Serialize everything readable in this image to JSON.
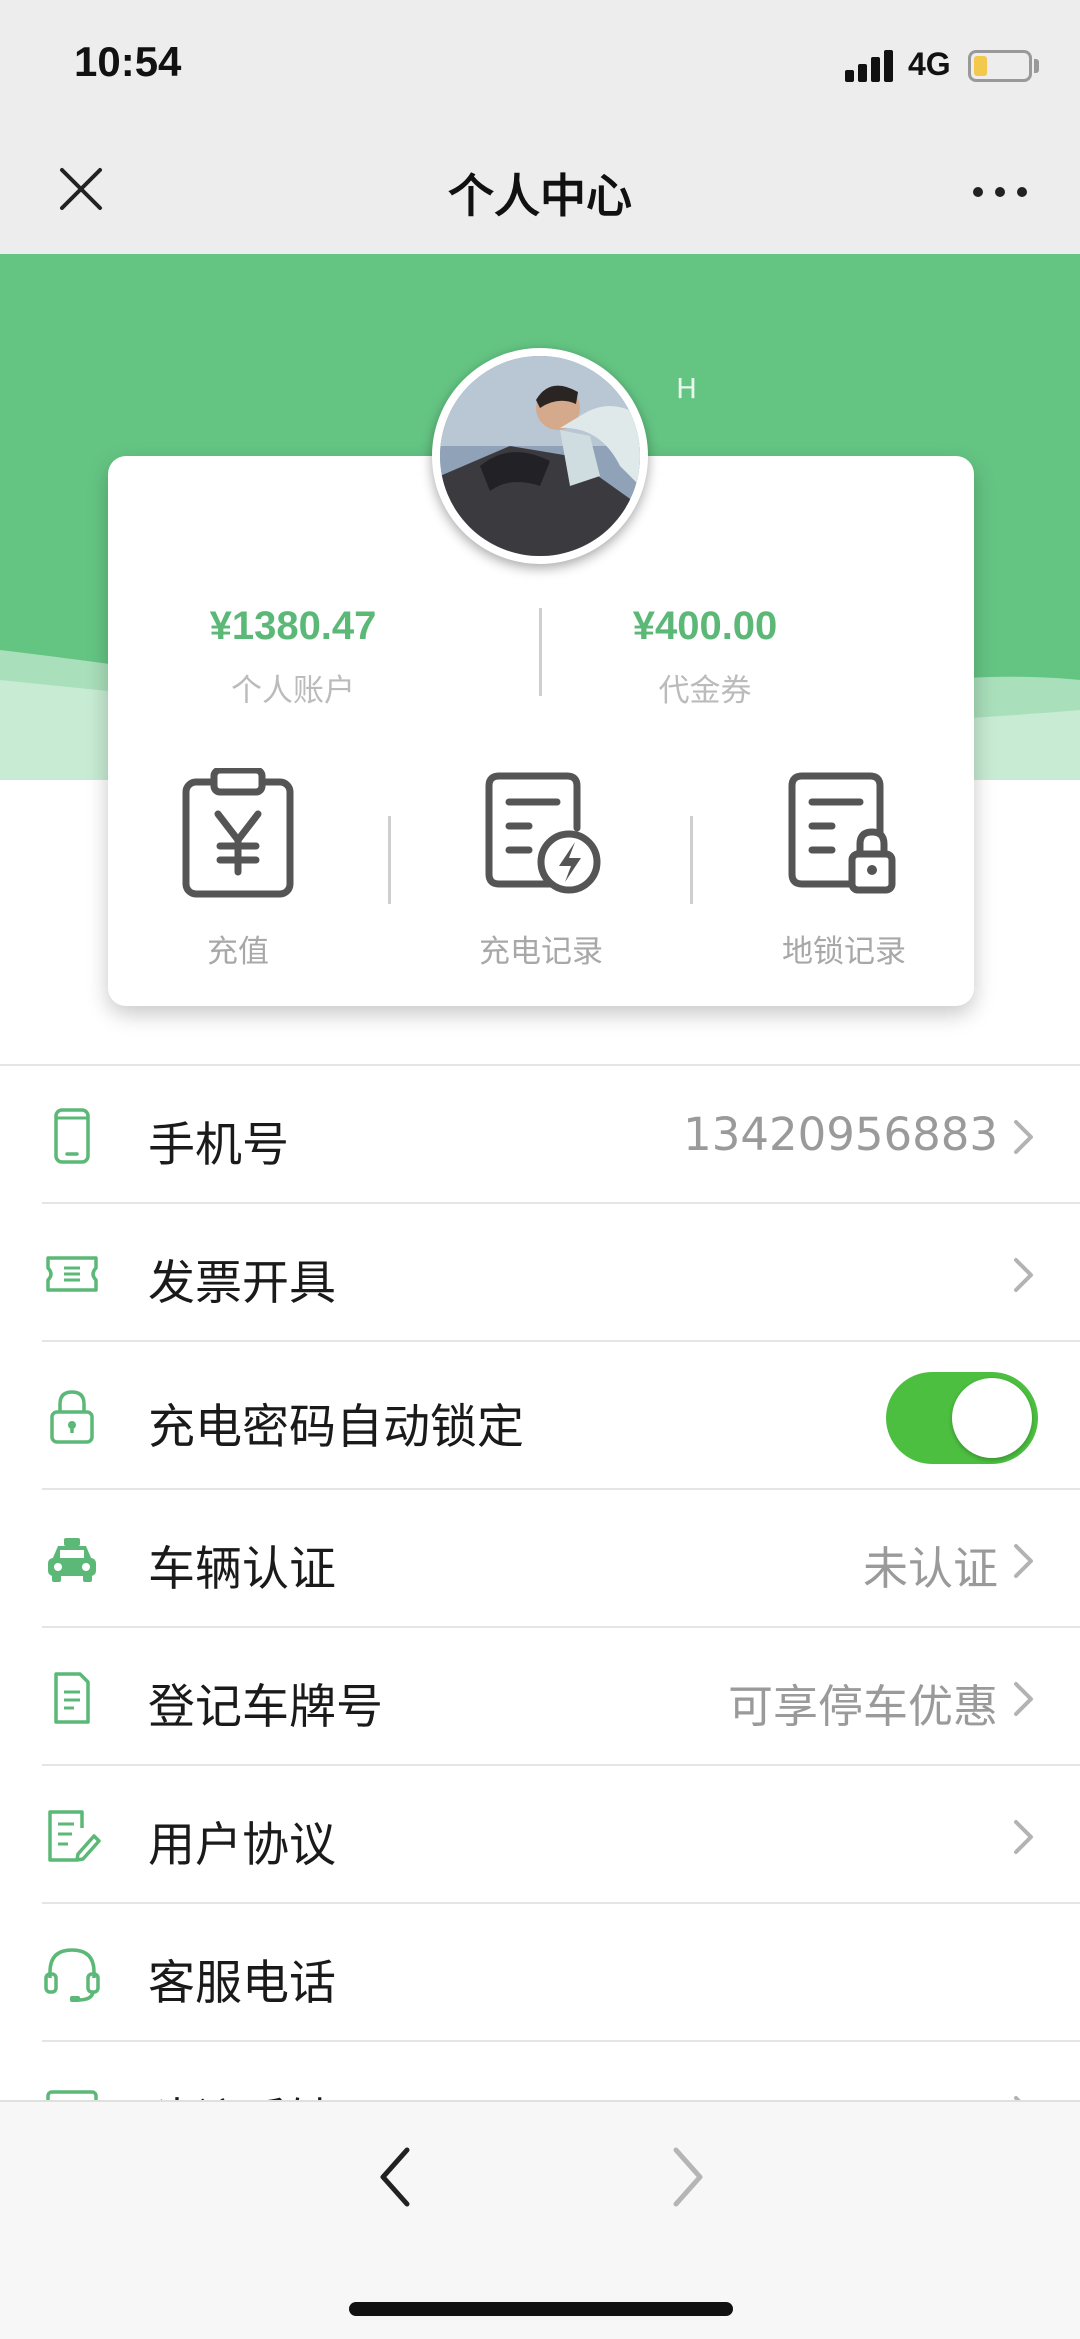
{
  "status_bar": {
    "time": "10:54",
    "network": "4G",
    "battery_level_percent": 25
  },
  "nav": {
    "title": "个人中心",
    "close_icon": "close-icon",
    "more_icon": "more-dots-icon"
  },
  "profile": {
    "name": "H",
    "avatar_icon": "avatar-photo"
  },
  "account": {
    "balance_amount": "¥1380.47",
    "balance_label": "个人账户",
    "coupon_amount": "¥400.00",
    "coupon_label": "代金券"
  },
  "actions": [
    {
      "label": "充值",
      "icon": "recharge-clipboard-yen-icon"
    },
    {
      "label": "充电记录",
      "icon": "charge-record-bolt-icon"
    },
    {
      "label": "地锁记录",
      "icon": "lock-record-icon"
    }
  ],
  "menu": [
    {
      "label": "手机号",
      "value": "13420956883",
      "icon": "phone-icon"
    },
    {
      "label": "发票开具",
      "value": "",
      "icon": "ticket-icon"
    },
    {
      "label": "充电密码自动锁定",
      "value": "",
      "icon": "lock-icon",
      "toggle_on": true
    },
    {
      "label": "车辆认证",
      "value": "未认证",
      "icon": "car-icon"
    },
    {
      "label": "登记车牌号",
      "value": "可享停车优惠",
      "icon": "document-icon"
    },
    {
      "label": "用户协议",
      "value": "",
      "icon": "agreement-edit-icon"
    },
    {
      "label": "客服电话",
      "value": "",
      "icon": "headset-icon"
    },
    {
      "label": "建议反馈",
      "value": "",
      "icon": "feedback-icon"
    }
  ],
  "colors": {
    "brand_green": "#64c583",
    "amount_green": "#5bb877",
    "toggle_green": "#4cbf40"
  },
  "bottom_nav": {
    "back_icon": "chevron-left-icon",
    "forward_icon": "chevron-right-icon"
  }
}
